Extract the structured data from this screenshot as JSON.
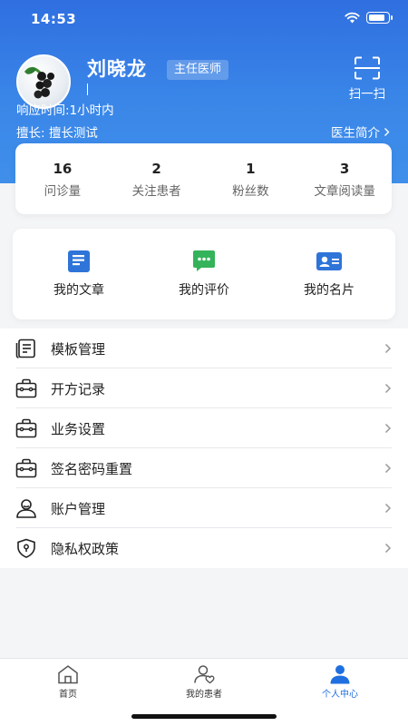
{
  "status_bar": {
    "time": "14:53",
    "battery_level": 0.85
  },
  "profile": {
    "name": "刘晓龙",
    "title": "主任医师",
    "response_time": "响应时间:1小时内",
    "specialty": "擅长: 擅长测试",
    "bio_link": "医生简介",
    "scan_label": "扫一扫"
  },
  "stats": [
    {
      "value": "16",
      "label": "问诊量"
    },
    {
      "value": "2",
      "label": "关注患者"
    },
    {
      "value": "1",
      "label": "粉丝数"
    },
    {
      "value": "3",
      "label": "文章阅读量"
    }
  ],
  "quick_actions": [
    {
      "label": "我的文章",
      "icon": "article-icon"
    },
    {
      "label": "我的评价",
      "icon": "comment-icon"
    },
    {
      "label": "我的名片",
      "icon": "business-card-icon"
    }
  ],
  "menu": [
    {
      "label": "模板管理",
      "icon": "template-icon"
    },
    {
      "label": "开方记录",
      "icon": "toolbox-icon"
    },
    {
      "label": "业务设置",
      "icon": "toolbox-icon"
    },
    {
      "label": "签名密码重置",
      "icon": "toolbox-icon"
    },
    {
      "label": "账户管理",
      "icon": "user-icon"
    },
    {
      "label": "隐私权政策",
      "icon": "shield-icon"
    }
  ],
  "tabbar": [
    {
      "label": "首页",
      "icon": "home-icon",
      "active": false
    },
    {
      "label": "我的患者",
      "icon": "patients-icon",
      "active": false
    },
    {
      "label": "个人中心",
      "icon": "person-icon",
      "active": true
    }
  ],
  "colors": {
    "primary": "#2f6fe0",
    "green": "#34b35a",
    "accent_blue": "#2f74d8"
  }
}
